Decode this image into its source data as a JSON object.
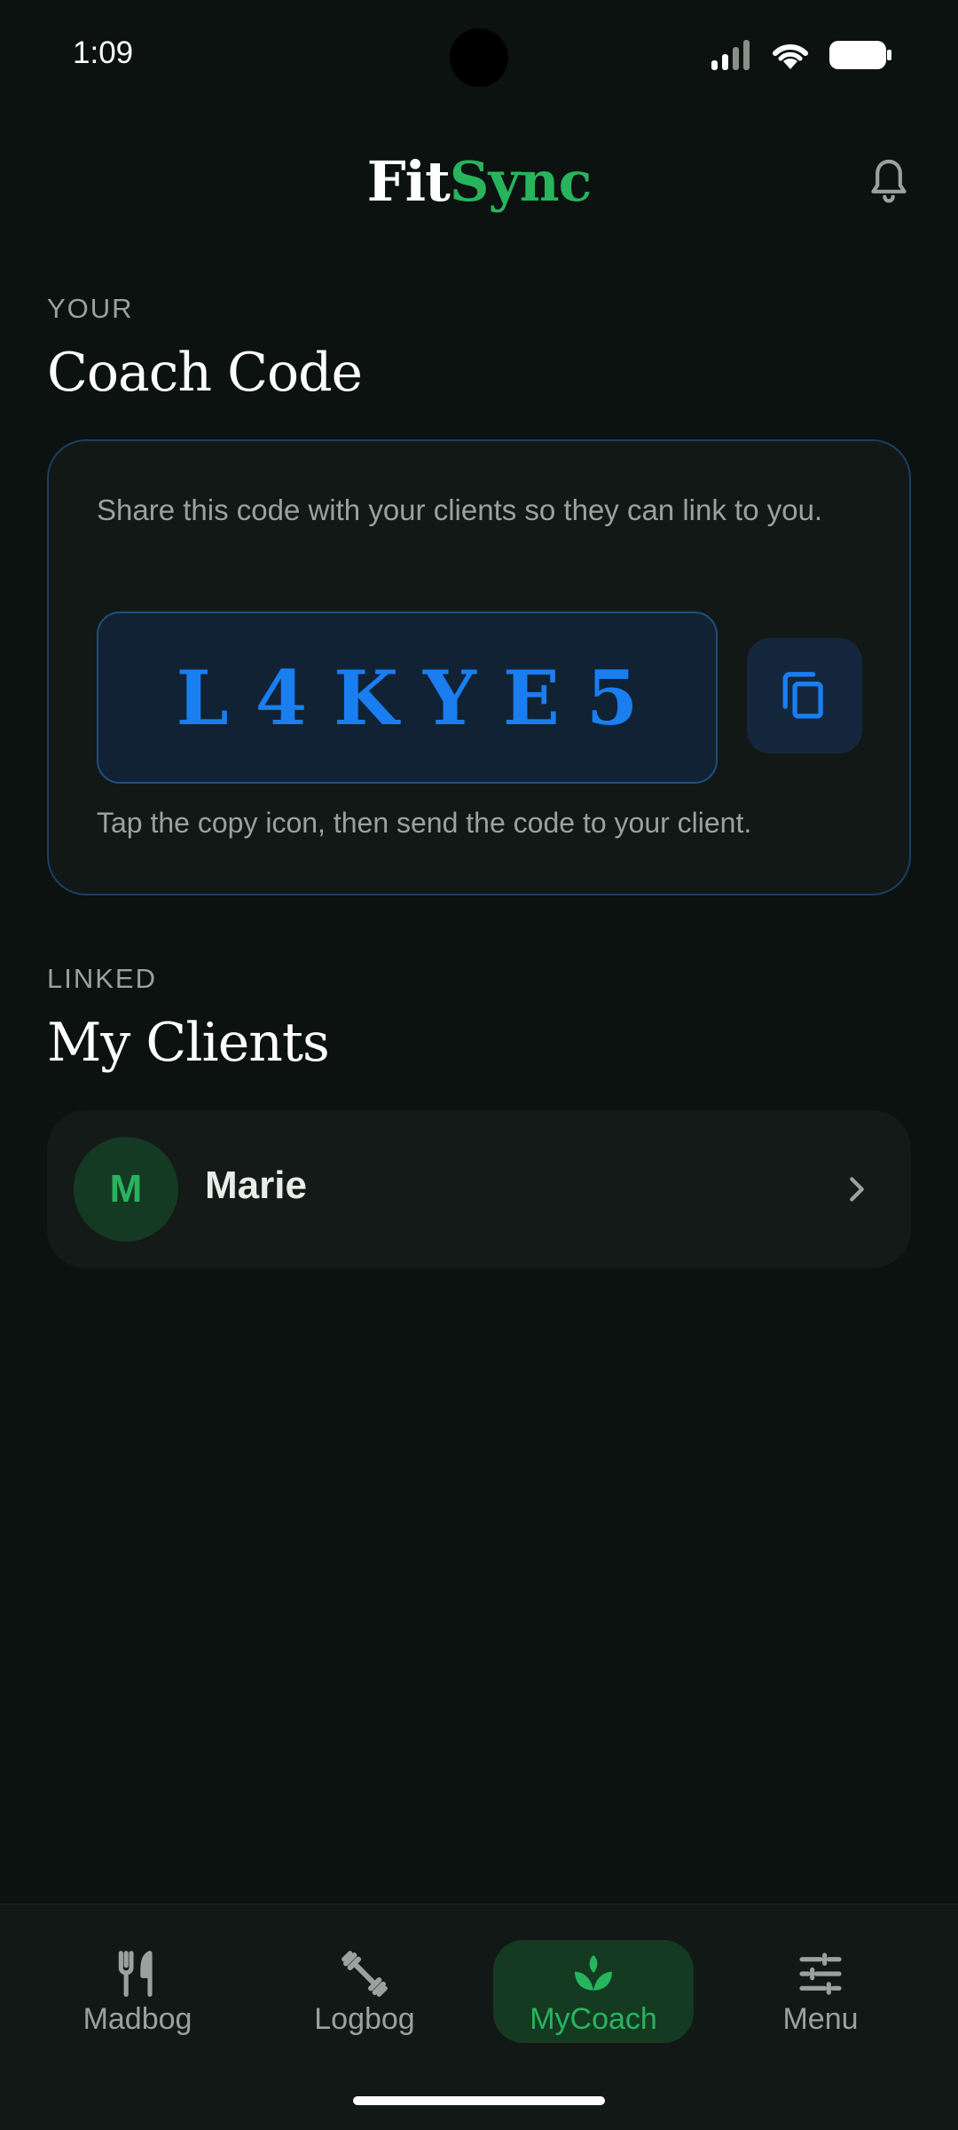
{
  "status_bar": {
    "time": "1:09"
  },
  "header": {
    "logo_part1": "Fit",
    "logo_part2": "Sync"
  },
  "coach_code_section": {
    "eyebrow": "YOUR",
    "title": "Coach Code",
    "description": "Share this code with your clients so they can link to you.",
    "code": "L4KYE5",
    "hint": "Tap the copy icon, then send the code to your client."
  },
  "clients_section": {
    "eyebrow": "LINKED",
    "title": "My Clients",
    "clients": [
      {
        "initial": "M",
        "name": "Marie"
      }
    ]
  },
  "bottom_nav": {
    "items": [
      {
        "label": "Madbog",
        "icon": "fork-knife-icon",
        "active": false
      },
      {
        "label": "Logbog",
        "icon": "dumbbell-icon",
        "active": false
      },
      {
        "label": "MyCoach",
        "icon": "sprout-icon",
        "active": true
      },
      {
        "label": "Menu",
        "icon": "sliders-icon",
        "active": false
      }
    ]
  },
  "colors": {
    "background": "#0c120f",
    "accent_green": "#27b45d",
    "code_blue": "#1a7ef0",
    "muted_text": "#9aa29d"
  }
}
